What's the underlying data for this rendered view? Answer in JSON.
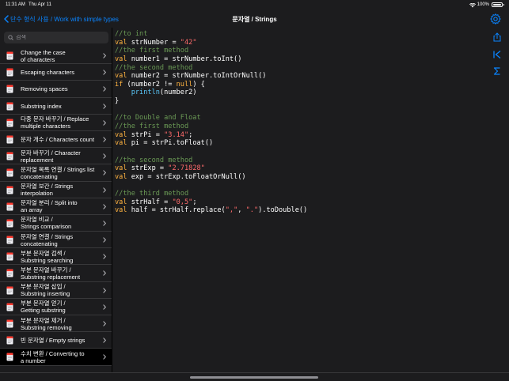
{
  "status_bar": {
    "time": "11:31 AM",
    "date": "Thu Apr 11",
    "battery": "100%"
  },
  "nav": {
    "back_label": "단수 형식 사용 / Work with simple types",
    "title": "문자열 / Strings"
  },
  "search": {
    "placeholder": "검색"
  },
  "sidebar": {
    "items": [
      {
        "label": "Change the case\nof characters"
      },
      {
        "label": "Escaping characters"
      },
      {
        "label": "Removing spaces"
      },
      {
        "label": "Substring index"
      },
      {
        "label": "다중 문자 바꾸기 / Replace\nmultiple characters"
      },
      {
        "label": "문자 개수 / Characters count"
      },
      {
        "label": "문자 바꾸기 / Character\nreplacement"
      },
      {
        "label": "문자열 목록 연결 / Strings list\nconcatenating"
      },
      {
        "label": "문자열 보간 / Strings\ninterpolation"
      },
      {
        "label": "문자열 분리 / Split into\nan array"
      },
      {
        "label": "문자열 비교 /\nStrings comparison"
      },
      {
        "label": "문자열 연결 / Strings\nconcatenating"
      },
      {
        "label": "부분 문자열 검색 /\nSubstring searching"
      },
      {
        "label": "부분 문자열 바꾸기 /\nSubstring replacement"
      },
      {
        "label": "부분 문자열 삽입 /\nSubstring inserting"
      },
      {
        "label": "부분 문자열 얻기 /\nGetting substring"
      },
      {
        "label": "부분 문자열 제거 /\nSubstring removing"
      },
      {
        "label": "빈 문자열 / Empty strings"
      },
      {
        "label": "수치 변환 / Converting to\na number",
        "selected": true
      }
    ]
  },
  "code": {
    "lines": [
      [
        [
          "comment",
          "//to int"
        ]
      ],
      [
        [
          "kw",
          "val"
        ],
        [
          "plain",
          " strNumber = "
        ],
        [
          "str",
          "\"42\""
        ]
      ],
      [
        [
          "comment",
          "//the first method"
        ]
      ],
      [
        [
          "kw",
          "val"
        ],
        [
          "plain",
          " number1 = strNumber.toInt()"
        ]
      ],
      [
        [
          "comment",
          "//the second method"
        ]
      ],
      [
        [
          "kw",
          "val"
        ],
        [
          "plain",
          " number2 = strNumber.toIntOrNull()"
        ]
      ],
      [
        [
          "kw",
          "if"
        ],
        [
          "plain",
          " (number2 != "
        ],
        [
          "kw",
          "null"
        ],
        [
          "plain",
          ") {"
        ]
      ],
      [
        [
          "plain",
          "    "
        ],
        [
          "fn",
          "println"
        ],
        [
          "plain",
          "(number2)"
        ]
      ],
      [
        [
          "plain",
          "}"
        ]
      ],
      [
        [
          "plain",
          ""
        ]
      ],
      [
        [
          "comment",
          "//to Double and Float"
        ]
      ],
      [
        [
          "comment",
          "//the first method"
        ]
      ],
      [
        [
          "kw",
          "val"
        ],
        [
          "plain",
          " strPi = "
        ],
        [
          "str",
          "\"3.14\""
        ],
        [
          "plain",
          ";"
        ]
      ],
      [
        [
          "kw",
          "val"
        ],
        [
          "plain",
          " pi = strPi.toFloat()"
        ]
      ],
      [
        [
          "plain",
          ""
        ]
      ],
      [
        [
          "comment",
          "//the second method"
        ]
      ],
      [
        [
          "kw",
          "val"
        ],
        [
          "plain",
          " strExp = "
        ],
        [
          "str",
          "\"2.71828\""
        ]
      ],
      [
        [
          "kw",
          "val"
        ],
        [
          "plain",
          " exp = strExp.toFloatOrNull()"
        ]
      ],
      [
        [
          "plain",
          ""
        ]
      ],
      [
        [
          "comment",
          "//the third method"
        ]
      ],
      [
        [
          "kw",
          "val"
        ],
        [
          "plain",
          " strHalf = "
        ],
        [
          "str",
          "\"0,5\""
        ],
        [
          "plain",
          ";"
        ]
      ],
      [
        [
          "kw",
          "val"
        ],
        [
          "plain",
          " half = strHalf.replace("
        ],
        [
          "str",
          "\",\""
        ],
        [
          "plain",
          ", "
        ],
        [
          "str",
          "\".\""
        ],
        [
          "plain",
          ").toDouble()"
        ]
      ]
    ]
  },
  "toolbar": {
    "icons": [
      "share-icon",
      "first-page-icon",
      "sigma-icon"
    ]
  },
  "colors": {
    "accent": "#0a84ff",
    "comment": "#6a9955",
    "keyword": "#ffb340",
    "string": "#ff6b6b",
    "function": "#5ac8fa"
  }
}
